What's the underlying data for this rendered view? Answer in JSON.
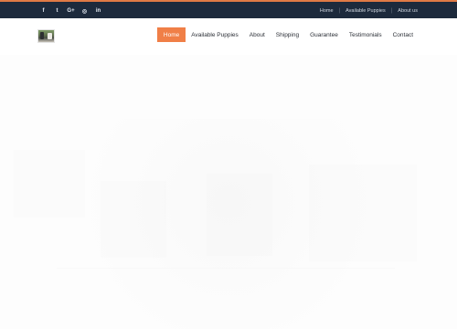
{
  "topbar": {
    "social_icons": [
      {
        "name": "facebook-icon",
        "glyph": "f"
      },
      {
        "name": "twitter-icon",
        "glyph": "t"
      },
      {
        "name": "google-plus-icon",
        "glyph": "G+"
      },
      {
        "name": "instagram-icon",
        "glyph": "◎"
      },
      {
        "name": "linkedin-icon",
        "glyph": "in"
      }
    ],
    "links": [
      "Home",
      "Available Puppies",
      "About us"
    ]
  },
  "nav": {
    "items": [
      "Home",
      "Available Puppies",
      "About",
      "Shipping",
      "Guarantee",
      "Testimonials",
      "Contact"
    ],
    "active_index": 0
  },
  "colors": {
    "topbar_bg": "#1d2a3c",
    "accent": "#f07f47",
    "text": "#2b2f36"
  }
}
